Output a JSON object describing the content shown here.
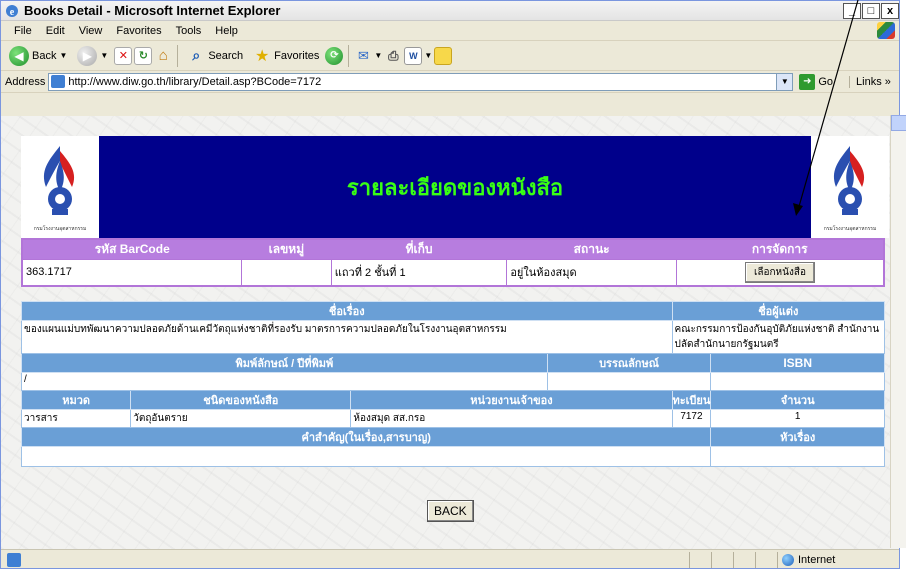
{
  "window": {
    "title": "Books Detail - Microsoft Internet Explorer",
    "min": "_",
    "max": "□",
    "close": "x"
  },
  "menu": [
    "File",
    "Edit",
    "View",
    "Favorites",
    "Tools",
    "Help"
  ],
  "toolbar": {
    "back": "Back",
    "search": "Search",
    "favorites": "Favorites"
  },
  "address": {
    "label": "Address",
    "url": "http://www.diw.go.th/library/Detail.asp?BCode=7172",
    "go": "Go",
    "links": "Links"
  },
  "page": {
    "title": "รายละเอียดของหนังสือ",
    "logo_caption": "กรมโรงงานอุตสาหกรรม",
    "table1": {
      "headers": [
        "รหัส BarCode",
        "เลขหมู่",
        "ที่เก็บ",
        "สถานะ",
        "การจัดการ"
      ],
      "row": [
        "363.1717",
        "",
        "แถวที่ 2 ชั้นที่ 1",
        "อยู่ในห้องสมุด"
      ],
      "select_button": "เลือกหนังสือ"
    },
    "table2": {
      "h_title": "ชื่อเรื่อง",
      "h_author": "ชื่อผู้แต่ง",
      "title_value": "ของแผนแม่บทพัฒนาความปลอดภัยด้านเคมีวัตถุแห่งชาติที่รองรับ มาตรการความปลอดภัยในโรงงานอุตสาหกรรม",
      "author_value": "คณะกรรมการป้องกันอุบัติภัยแห่งชาติ สำนักงานปลัดสำนักนายกรัฐมนตรี",
      "h_pub": "พิมพ์ลักษณ์ / ปีที่พิมพ์",
      "h_biblio": "บรรณลักษณ์",
      "h_isbn": "ISBN",
      "pub_value": "/",
      "h_category": "หมวด",
      "h_type": "ชนิดของหนังสือ",
      "h_owner": "หน่วยงานเจ้าของ",
      "h_reg": "ทะเบียน",
      "h_qty": "จำนวน",
      "category_value": "วารสาร",
      "type_value": "วัตถุอันตราย",
      "owner_value": "ห้องสมุด สส.กรอ",
      "reg_value": "7172",
      "qty_value": "1",
      "h_keywords": "คำสำคัญ(ในเรื่อง,สารบาญ)",
      "h_subject": "หัวเรื่อง"
    },
    "back_button": "BACK"
  },
  "status": {
    "zone": "Internet"
  }
}
